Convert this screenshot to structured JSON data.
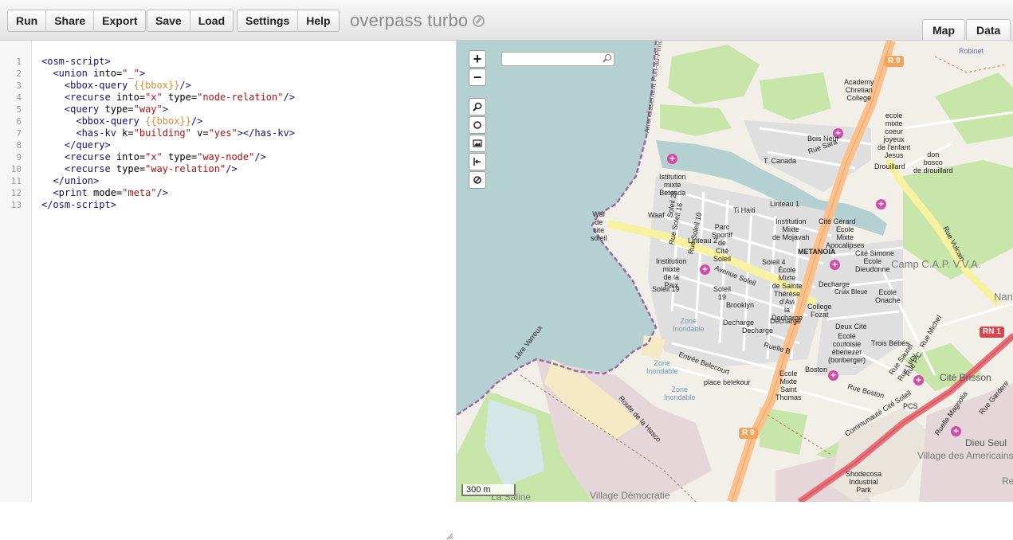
{
  "toolbar": {
    "group1": [
      "Run",
      "Share",
      "Export"
    ],
    "group2": [
      "Save",
      "Load"
    ],
    "group3": [
      "Settings",
      "Help"
    ],
    "title": "overpass turbo",
    "tabs": [
      "Map",
      "Data"
    ]
  },
  "editor": {
    "line_numbers": [
      "1",
      "2",
      "3",
      "4",
      "5",
      "6",
      "7",
      "8",
      "9",
      "10",
      "11",
      "12",
      "13"
    ],
    "code_lines": [
      "<osm-script>",
      "  <union into=\"_\">",
      "    <bbox-query {{bbox}}/>",
      "    <recurse into=\"x\" type=\"node-relation\"/>",
      "    <query type=\"way\">",
      "      <bbox-query {{bbox}}/>",
      "      <has-kv k=\"building\" v=\"yes\"></has-kv>",
      "    </query>",
      "    <recurse into=\"x\" type=\"way-node\"/>",
      "    <recurse type=\"way-relation\"/>",
      "  </union>",
      "  <print mode=\"meta\"/>",
      "</osm-script>"
    ]
  },
  "map": {
    "zoom_in": "+",
    "zoom_out": "−",
    "scale": "300 m",
    "shields": {
      "r9_top": "R 9",
      "r9_bottom": "R 9",
      "rn1": "RN 1"
    },
    "labels": {
      "robinet": "Robinet",
      "academy": "Academy\nChretian\nCollege",
      "ecole_mixte_coeur": "ecole\nmixte\ncoeur\njoyeux\nde l'enfant\nJesus",
      "don_bosco": "don\nbosco\nde drouillard",
      "bois_neuf": "Bois Neuf",
      "rue_sara": "Rue Sara",
      "t_canada": "T. Canada",
      "drouillard": "Drouillard",
      "institution_betesda": "Istitution\nmixte\nBetesda",
      "waf_cite_soleil": "Waf\nde\ncite\nsoleil",
      "waaf": "Waaf",
      "soleil_26": "Soleil 26",
      "rue_soleil_16": "Rue Soleil 16",
      "rue_soleil_10": "Rue Soleil 10",
      "ti_haiti": "Ti Haiti",
      "linteau_1": "Linteau 1",
      "linteau_2": "Linteau 2",
      "parc_sportif": "Parc\nSportif\nde\nCité\nSoleil",
      "institution_mojavah": "Institution\nMixte\nde Mojavah",
      "cite_gerard": "Cité Gérard",
      "ecole_apocalipses": "Ecole\nMixte\nApocalipses",
      "rue_vulcain": "Rue Vulcain",
      "metanoia": "METANOIA",
      "cite_simone": "Cité Simone",
      "ecole_dieudonne": "Ecole\nDieudonne",
      "camp_capvva": "Camp C.A.P. V.V.A.",
      "nann": "Nann",
      "institution_paix": "Institution\nmixte\nde la\nPaix",
      "avenue_soleil": "Avenue Soleil",
      "soleil_4": "Soleil 4",
      "ecole_sainte_therese": "École\nMixte\nde Sainte\nThérèse\nd'Avi\nla\nDecharge",
      "decharge_1": "Decharge",
      "cruix_bleue": "Cruix Bleue",
      "ecole_onache": "Ecole\nOnache",
      "soleil_19a": "Soleil 19",
      "soleil_19b": "Soleil\n19",
      "brooklyn": "Brooklyn",
      "college_fozat": "College\nFozat",
      "decharge_2": "Decharge",
      "decharge_3": "Decharge",
      "decharge_4": "Decharge",
      "zone_inondable_1": "Zone\nInondable",
      "zone_inondable_2": "Zone\nInondable",
      "zone_inondable_3": "Zone\nInondable",
      "deux_cite": "Deux Cité",
      "ecole_couvoisie": "Ecole\ncoutoisie\nébenezer\n(bonberger)",
      "trois_bebes": "Trois Bébés",
      "rue_michel": "Rue Michel",
      "ruelle_b": "Ruelle B",
      "entree_belecourt": "Entrée Belecourt",
      "place_belekour": "place belekour",
      "boston": "Boston",
      "ecole_saint_thomas": "Ecole\nMixte\nSaint\nThomas",
      "rue_boston": "Rue Boston",
      "rue_saurel": "Rue Saurel",
      "rue_pic": "Rue P.C.",
      "rue_lucy": "Rue Lucy",
      "cite_brisson": "Cité Brisson",
      "pcs": "PCS",
      "communaute_cite_soleil": "Communauté Cité Soleil",
      "ruelle_magnolia": "Ruelle Magnolia",
      "rue_gardere": "Rue Gardere",
      "dieu_seul": "Dieu Seul",
      "village_americains": "Village des Americains",
      "shodecosa": "Shodecosa\nIndustrial\nPark",
      "village_democratie": "Village Démocratie",
      "route_hasco": "Route de la Hasco",
      "ere_varreux": "1ère Varreux",
      "arrondissement": "Arrondissement Port-au-Prince",
      "la_saline": "La Saline",
      "re": "Re"
    }
  },
  "colors": {
    "water": "#b5d0d0",
    "land": "#f2efe9",
    "park": "#c8e6a9",
    "primary_road": "#fbc08b",
    "secondary_road": "#f6f2a0",
    "trunk_road": "#e8707a",
    "poi": "#d44aa7"
  }
}
